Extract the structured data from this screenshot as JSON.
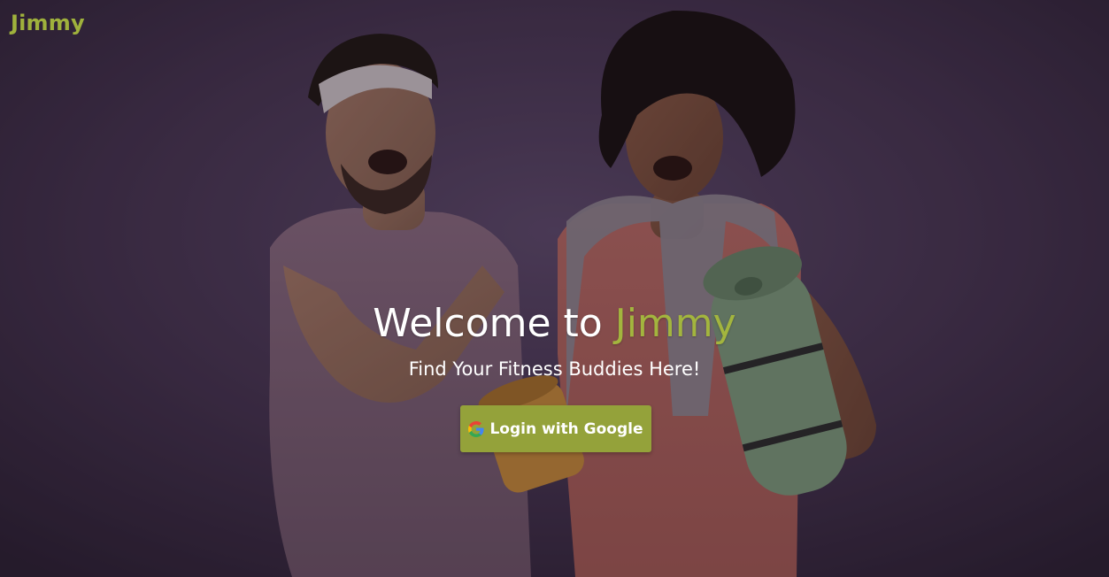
{
  "brand": {
    "name": "Jimmy"
  },
  "hero": {
    "headline_prefix": "Welcome to",
    "headline_accent": "Jimmy",
    "tagline": "Find Your Fitness Buddies Here!",
    "image_icon": "fitness-people-photo"
  },
  "login": {
    "label": "Login with Google",
    "icon": "google-icon"
  },
  "colors": {
    "accent": "#a3b53e",
    "button_bg": "#94a23a",
    "background": "#3a2c45"
  }
}
